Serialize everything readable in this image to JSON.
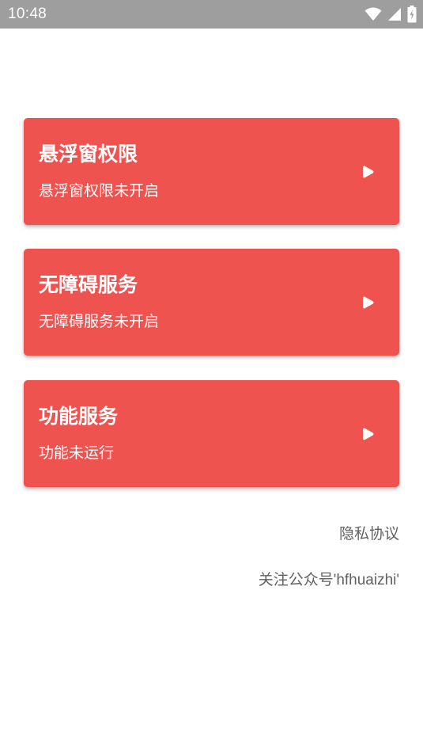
{
  "status_bar": {
    "time": "10:48",
    "icons": [
      "wifi-icon",
      "signal-icon",
      "battery-icon"
    ]
  },
  "cards": [
    {
      "title": "悬浮窗权限",
      "subtitle": "悬浮窗权限未开启",
      "icon": "play-arrow-icon"
    },
    {
      "title": "无障碍服务",
      "subtitle": "无障碍服务未开启",
      "icon": "play-arrow-icon"
    },
    {
      "title": "功能服务",
      "subtitle": "功能未运行",
      "icon": "play-arrow-icon"
    }
  ],
  "links": {
    "privacy": "隐私协议",
    "follow": "关注公众号'hfhuaizhi'"
  },
  "colors": {
    "status_bar": "#9e9e9e",
    "card": "#ef5350",
    "link_text": "#616161"
  }
}
